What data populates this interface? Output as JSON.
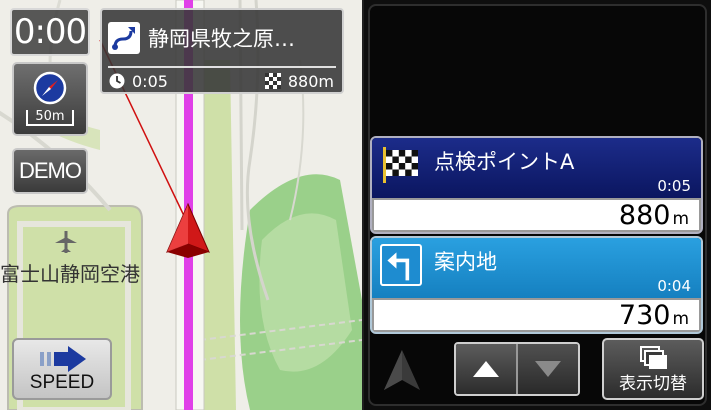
{
  "map": {
    "clock": "0:00",
    "destination": {
      "name": "静岡県牧之原…",
      "time": "0:05",
      "distance": "880m"
    },
    "scale_label": "50m",
    "demo_label": "DEMO",
    "speed_label": "SPEED",
    "airport_label": "富士山静岡空港"
  },
  "panel": {
    "waypoint": {
      "name": "点検ポイントA",
      "eta": "0:05",
      "distance": "880",
      "unit": "m"
    },
    "guide": {
      "name": "案内地",
      "eta": "0:04",
      "distance": "730",
      "unit": "m"
    },
    "switch_label": "表示切替"
  },
  "colors": {
    "route": "#e040e8",
    "waypoint_card": "#13207a",
    "guide_card": "#1e8cd0",
    "vehicle": "#d01818"
  }
}
